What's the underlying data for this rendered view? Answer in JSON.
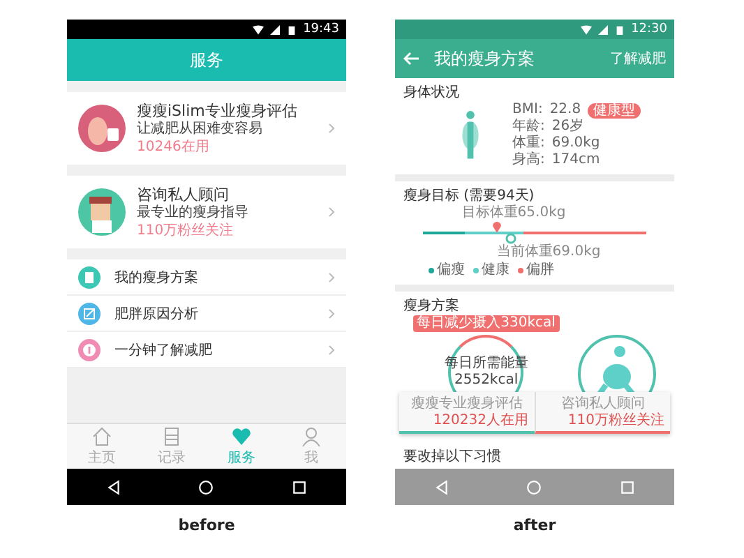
{
  "before": {
    "status_bar": {
      "time": "19:43"
    },
    "header": {
      "title": "服务"
    },
    "featured": [
      {
        "title": "瘦瘦iSlim专业瘦身评估",
        "subtitle": "让减肥从困难变容易",
        "count": "10246在用",
        "kind": "scale"
      },
      {
        "title": "咨询私人顾问",
        "subtitle": "最专业的瘦身指导",
        "count": "110万粉丝关注",
        "kind": "advisor"
      }
    ],
    "menu": [
      {
        "label": "我的瘦身方案",
        "kind": "document",
        "color": "#3cc8b4"
      },
      {
        "label": "肥胖原因分析",
        "kind": "edit",
        "color": "#4fb6e8"
      },
      {
        "label": "一分钟了解减肥",
        "kind": "number",
        "color": "#f08cb4"
      }
    ],
    "tabs": [
      {
        "label": "主页",
        "kind": "home",
        "selected": false
      },
      {
        "label": "记录",
        "kind": "document",
        "selected": false
      },
      {
        "label": "服务",
        "kind": "heart",
        "selected": true
      },
      {
        "label": "我",
        "kind": "person",
        "selected": false
      }
    ],
    "caption": "before"
  },
  "after": {
    "status_bar": {
      "time": "12:30"
    },
    "header": {
      "title": "我的瘦身方案",
      "action": "了解减肥"
    },
    "body_status": {
      "title": "身体状况",
      "stats": [
        {
          "label": "BMI:",
          "value": "22.8",
          "tag": "健康型"
        },
        {
          "label": "年龄:",
          "value": "26岁"
        },
        {
          "label": "体重:",
          "value": "69.0kg"
        },
        {
          "label": "身高:",
          "value": "174cm"
        }
      ]
    },
    "goal": {
      "title": "瘦身目标 (需要94天)",
      "target_label": "目标体重65.0kg",
      "current_label": "当前体重69.0kg",
      "legend": [
        {
          "label": "偏瘦",
          "color": "#1fa89a"
        },
        {
          "label": "健康",
          "color": "#5fd0c8"
        },
        {
          "label": "偏胖",
          "color": "#f07070"
        }
      ]
    },
    "plan": {
      "title": "瘦身方案",
      "badge": "每日减少摄入330kcal",
      "ring_title": "每日所需能量",
      "ring_value": "2552kcal",
      "actions": [
        {
          "label": "瘦瘦专业瘦身评估",
          "count": "120232人在用"
        },
        {
          "label": "咨询私人顾问",
          "count": "110万粉丝关注"
        }
      ],
      "footer_text": "要改掉以下习惯"
    },
    "caption": "after"
  }
}
